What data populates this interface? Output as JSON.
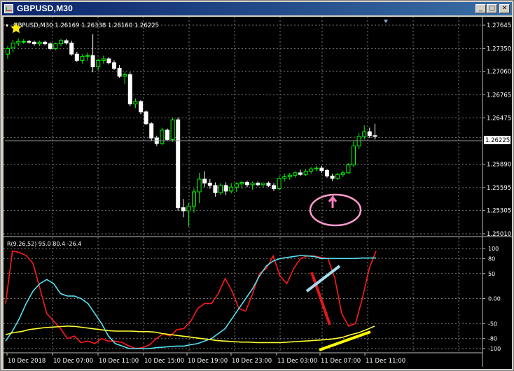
{
  "window": {
    "title": "GBPUSD,M30",
    "icon": "chart-window-icon",
    "buttons": {
      "minimize": "_",
      "restore": "□",
      "close": "✕"
    }
  },
  "chart_info": {
    "symbol_line": "GBPUSD,M30  1.26169 1.26338 1.26160 1.26225",
    "current_price": "1.26225"
  },
  "indicator": {
    "label": "R(9,26,52) 95.0 80.4 -26.4",
    "levels": [
      "100",
      "80",
      "50",
      "0.00",
      "-50",
      "-80",
      "-100"
    ]
  },
  "price_axis": [
    "1.27645",
    "1.27350",
    "1.27060",
    "1.26765",
    "1.26475",
    "1.26225",
    "1.25890",
    "1.25595",
    "1.25305",
    "1.25010"
  ],
  "time_axis": [
    "10 Dec 2018",
    "10 Dec 07:00",
    "10 Dec 11:00",
    "10 Dec 15:00",
    "10 Dec 19:00",
    "10 Dec 23:00",
    "11 Dec 03:00",
    "11 Dec 07:00",
    "11 Dec 11:00"
  ],
  "colors": {
    "background": "#000000",
    "bull_candle": "#00ff00",
    "bear_candle": "#ffffff",
    "grid": "#7a7a7a",
    "line_red": "#ff1a1a",
    "line_cyan": "#55e0f0",
    "line_yellow": "#ffff33",
    "annotation_pink": "#ff8fc8"
  },
  "chart_data": {
    "type": "candlestick",
    "price_range": [
      1.2501,
      1.27645
    ],
    "indicator_range": [
      -100,
      100
    ],
    "candles": [
      [
        1.2728,
        1.2738,
        1.2722,
        1.2735
      ],
      [
        1.2736,
        1.2746,
        1.273,
        1.2742
      ],
      [
        1.2742,
        1.2748,
        1.2738,
        1.2744
      ],
      [
        1.2744,
        1.2747,
        1.2741,
        1.2744
      ],
      [
        1.2744,
        1.2746,
        1.2741,
        1.2743
      ],
      [
        1.2743,
        1.2745,
        1.2739,
        1.2741
      ],
      [
        1.2741,
        1.2745,
        1.2738,
        1.2743
      ],
      [
        1.2743,
        1.2745,
        1.2739,
        1.2741
      ],
      [
        1.2741,
        1.2743,
        1.2733,
        1.2735
      ],
      [
        1.2735,
        1.2742,
        1.2733,
        1.2741
      ],
      [
        1.2741,
        1.2747,
        1.2738,
        1.2745
      ],
      [
        1.2745,
        1.2747,
        1.274,
        1.2742
      ],
      [
        1.2742,
        1.2745,
        1.2726,
        1.2728
      ],
      [
        1.2728,
        1.2731,
        1.2718,
        1.272
      ],
      [
        1.272,
        1.2728,
        1.2716,
        1.2725
      ],
      [
        1.2725,
        1.273,
        1.272,
        1.2726
      ],
      [
        1.2726,
        1.2753,
        1.2705,
        1.2712
      ],
      [
        1.2712,
        1.2722,
        1.2708,
        1.272
      ],
      [
        1.272,
        1.2726,
        1.2716,
        1.2722
      ],
      [
        1.2722,
        1.2724,
        1.2715,
        1.2717
      ],
      [
        1.2717,
        1.272,
        1.2708,
        1.271
      ],
      [
        1.271,
        1.2714,
        1.2698,
        1.27
      ],
      [
        1.27,
        1.2705,
        1.269,
        1.2702
      ],
      [
        1.2702,
        1.2705,
        1.2662,
        1.2665
      ],
      [
        1.2665,
        1.2672,
        1.266,
        1.2668
      ],
      [
        1.2668,
        1.267,
        1.2652,
        1.2655
      ],
      [
        1.2655,
        1.2657,
        1.2638,
        1.264
      ],
      [
        1.264,
        1.2642,
        1.2618,
        1.2622
      ],
      [
        1.2622,
        1.2625,
        1.2612,
        1.2615
      ],
      [
        1.2615,
        1.2635,
        1.2613,
        1.2632
      ],
      [
        1.2632,
        1.2634,
        1.2618,
        1.262
      ],
      [
        1.262,
        1.2648,
        1.2617,
        1.2645
      ],
      [
        1.2645,
        1.2648,
        1.253,
        1.2534
      ],
      [
        1.2534,
        1.2545,
        1.2522,
        1.253
      ],
      [
        1.253,
        1.254,
        1.251,
        1.2536
      ],
      [
        1.2536,
        1.2558,
        1.2528,
        1.2554
      ],
      [
        1.2554,
        1.2578,
        1.254,
        1.257
      ],
      [
        1.257,
        1.258,
        1.256,
        1.2565
      ],
      [
        1.2565,
        1.257,
        1.2558,
        1.2562
      ],
      [
        1.2562,
        1.2566,
        1.2548,
        1.2553
      ],
      [
        1.2553,
        1.2565,
        1.255,
        1.2562
      ],
      [
        1.2562,
        1.2566,
        1.255,
        1.2555
      ],
      [
        1.2555,
        1.2565,
        1.2552,
        1.256
      ],
      [
        1.256,
        1.2566,
        1.2554,
        1.2564
      ],
      [
        1.2564,
        1.2568,
        1.2558,
        1.2566
      ],
      [
        1.2566,
        1.2568,
        1.256,
        1.2563
      ],
      [
        1.2563,
        1.2567,
        1.2557,
        1.2565
      ],
      [
        1.2565,
        1.2567,
        1.2561,
        1.2563
      ],
      [
        1.2563,
        1.2566,
        1.2559,
        1.2565
      ],
      [
        1.2565,
        1.2567,
        1.256,
        1.2562
      ],
      [
        1.2562,
        1.2565,
        1.2555,
        1.2558
      ],
      [
        1.2558,
        1.2574,
        1.2556,
        1.2571
      ],
      [
        1.2571,
        1.2577,
        1.2567,
        1.2573
      ],
      [
        1.2573,
        1.2578,
        1.2569,
        1.2575
      ],
      [
        1.2575,
        1.258,
        1.2572,
        1.2578
      ],
      [
        1.2578,
        1.2582,
        1.2574,
        1.2576
      ],
      [
        1.2576,
        1.2583,
        1.2574,
        1.258
      ],
      [
        1.258,
        1.2585,
        1.2577,
        1.2583
      ],
      [
        1.2583,
        1.2587,
        1.258,
        1.2584
      ],
      [
        1.2584,
        1.2587,
        1.2578,
        1.2581
      ],
      [
        1.2581,
        1.2583,
        1.2572,
        1.2574
      ],
      [
        1.2574,
        1.2577,
        1.2568,
        1.2571
      ],
      [
        1.2571,
        1.2578,
        1.2569,
        1.2576
      ],
      [
        1.2576,
        1.258,
        1.2573,
        1.2578
      ],
      [
        1.2578,
        1.259,
        1.2577,
        1.2588
      ],
      [
        1.2588,
        1.2618,
        1.2585,
        1.2612
      ],
      [
        1.2612,
        1.2628,
        1.2608,
        1.2624
      ],
      [
        1.2624,
        1.2638,
        1.262,
        1.263
      ],
      [
        1.263,
        1.2635,
        1.2622,
        1.2625
      ],
      [
        1.2625,
        1.264,
        1.262,
        1.2624
      ]
    ],
    "indicator_series": [
      {
        "name": "",
        "color": "red",
        "values": [
          -10,
          95,
          92,
          86,
          70,
          20,
          -30,
          -45,
          -60,
          -80,
          -75,
          -88,
          -85,
          -90,
          -80,
          -85,
          -85,
          -88,
          -95,
          -100,
          -98,
          -92,
          -80,
          -70,
          -75,
          -62,
          -60,
          -45,
          -20,
          -10,
          -10,
          10,
          40,
          15,
          -20,
          -25,
          10,
          50,
          60,
          85,
          45,
          30,
          60,
          80,
          85,
          85,
          82,
          80,
          40,
          -30,
          -55,
          -50,
          0,
          60,
          95
        ]
      },
      {
        "name": "",
        "color": "cyan",
        "values": [
          -85,
          -65,
          -40,
          -10,
          15,
          30,
          38,
          30,
          10,
          5,
          5,
          0,
          -10,
          -30,
          -50,
          -75,
          -90,
          -95,
          -100,
          -100,
          -100,
          -100,
          -98,
          -97,
          -96,
          -95,
          -95,
          -92,
          -90,
          -85,
          -80,
          -70,
          -60,
          -40,
          -20,
          0,
          20,
          45,
          65,
          75,
          80,
          82,
          84,
          86,
          85,
          84,
          80,
          80,
          80,
          80,
          80,
          80,
          81,
          81,
          81
        ]
      },
      {
        "name": "",
        "color": "yellow",
        "values": [
          -72,
          -68,
          -66,
          -62,
          -60,
          -58,
          -57,
          -56,
          -55,
          -56,
          -58,
          -60,
          -62,
          -64,
          -65,
          -65,
          -65,
          -66,
          -66,
          -67,
          -70,
          -72,
          -74,
          -76,
          -78,
          -80,
          -82,
          -84,
          -85,
          -86,
          -87,
          -87,
          -88,
          -88,
          -88,
          -88,
          -87,
          -86,
          -85,
          -84,
          -83,
          -82,
          -80,
          -77,
          -72,
          -68,
          -62,
          -55
        ]
      }
    ]
  }
}
